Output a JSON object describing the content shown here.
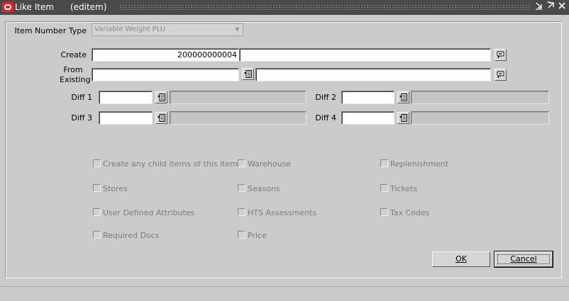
{
  "window": {
    "title": "Like Item",
    "form_name": "(editem)",
    "controls": [
      "minimize",
      "maximize",
      "close"
    ]
  },
  "form": {
    "item_number_type": {
      "label": "Item Number Type",
      "value": "Variable Weight PLU"
    },
    "create": {
      "label": "Create",
      "item_value": "200000000004",
      "desc_value": ""
    },
    "from_existing": {
      "label": "From\nExisting",
      "item_value": "",
      "desc_value": ""
    },
    "diffs": [
      {
        "label": "Diff 1",
        "value": "",
        "desc": ""
      },
      {
        "label": "Diff 2",
        "value": "",
        "desc": ""
      },
      {
        "label": "Diff 3",
        "value": "",
        "desc": ""
      },
      {
        "label": "Diff 4",
        "value": "",
        "desc": ""
      }
    ]
  },
  "options": [
    {
      "label": "Create any child items of this item",
      "checked": false
    },
    {
      "label": "Warehouse",
      "checked": false
    },
    {
      "label": "Replenishment",
      "checked": false
    },
    {
      "label": "Stores",
      "checked": false
    },
    {
      "label": "Seasons",
      "checked": false
    },
    {
      "label": "Tickets",
      "checked": false
    },
    {
      "label": "User Defined Attributes",
      "checked": false
    },
    {
      "label": "HTS Assessments",
      "checked": false
    },
    {
      "label": "Tax Codes",
      "checked": false
    },
    {
      "label": "Required Docs",
      "checked": false
    },
    {
      "label": "Price",
      "checked": false
    }
  ],
  "buttons": {
    "ok": "OK",
    "cancel": "Cancel"
  },
  "icons": {
    "lov": "list-of-values-icon",
    "edit": "comment-edit-icon"
  }
}
